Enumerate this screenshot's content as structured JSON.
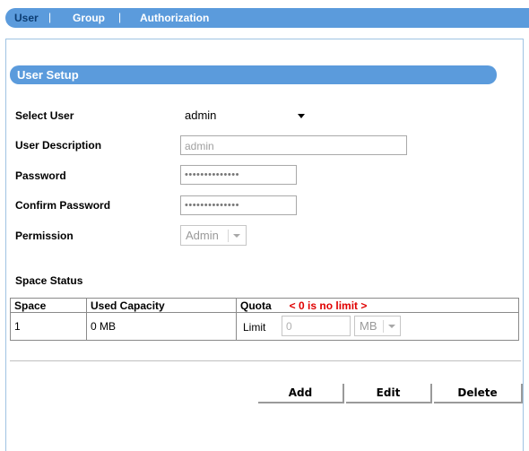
{
  "tabs": [
    {
      "label": "User",
      "active": true
    },
    {
      "label": "Group",
      "active": false
    },
    {
      "label": "Authorization",
      "active": false
    }
  ],
  "tab_separator": "|",
  "section": {
    "title": "User Setup"
  },
  "form": {
    "select_user": {
      "label": "Select User",
      "value": "admin"
    },
    "user_description": {
      "label": "User Description",
      "value": "admin"
    },
    "password": {
      "label": "Password",
      "value": "••••••••••••••"
    },
    "confirm_password": {
      "label": "Confirm Password",
      "value": "••••••••••••••"
    },
    "permission": {
      "label": "Permission",
      "value": "Admin"
    }
  },
  "space_status": {
    "title": "Space Status",
    "headers": {
      "space": "Space",
      "used": "Used Capacity",
      "quota": "Quota",
      "quota_note": "< 0 is no limit >"
    },
    "row": {
      "space": "1",
      "used": "0 MB",
      "limit_label": "Limit",
      "limit_placeholder": "0",
      "unit": "MB"
    }
  },
  "buttons": {
    "add": "Add",
    "edit": "Edit",
    "delete": "Delete"
  },
  "colors": {
    "accent": "#5b9bdc",
    "active_tab": "#0c3d73",
    "warning": "#e00000"
  }
}
